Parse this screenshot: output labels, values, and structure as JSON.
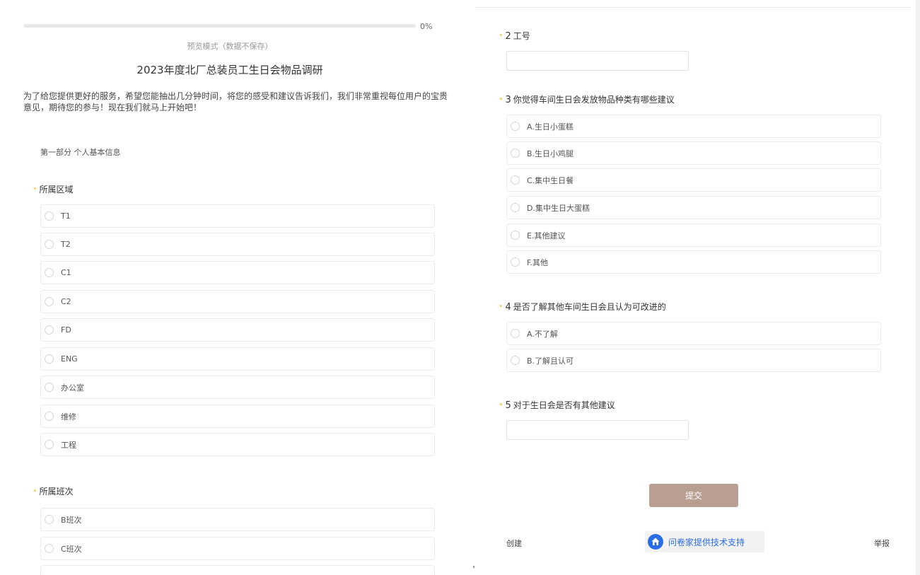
{
  "progress": {
    "percent_text": "0%",
    "value": 0
  },
  "preview_note": "预览模式（数据不保存）",
  "survey": {
    "title": "2023年度北厂总装员工生日会物品调研",
    "intro": "为了给您提供更好的服务，希望您能抽出几分钟时间，将您的感受和建议告诉我们，我们非常重视每位用户的宝贵意见，期待您的参与！现在我们就马上开始吧！",
    "section_title": "第一部分 个人基本信息"
  },
  "q_area": {
    "star": "*",
    "title": "所属区域",
    "options": [
      "T1",
      "T2",
      "C1",
      "C2",
      "FD",
      "ENG",
      "办公室",
      "维修",
      "工程"
    ]
  },
  "q_shift": {
    "star": "*",
    "title": "所属班次",
    "options": [
      "B班次",
      "C班次"
    ]
  },
  "q2": {
    "star": "*",
    "number": "2",
    "title": "工号",
    "value": ""
  },
  "q3": {
    "star": "*",
    "number": "3",
    "title": "你觉得车间生日会发放物品种类有哪些建议",
    "options": [
      "A.生日小蛋糕",
      "B.生日小鸡腿",
      "C.集中生日餐",
      "D.集中生日大蛋糕",
      "E.其他建议",
      "F.其他"
    ]
  },
  "q4": {
    "star": "*",
    "number": "4",
    "title": "是否了解其他车间生日会且认为可改进的",
    "options": [
      "A.不了解",
      "B.了解且认可"
    ]
  },
  "q5": {
    "star": "*",
    "number": "5",
    "title": "对于生日会是否有其他建议",
    "value": ""
  },
  "submit_label": "提交",
  "footer": {
    "create": "创建",
    "tech_support": "问卷家提供技术支持",
    "report": "举报"
  },
  "colors": {
    "accent": "#b89f92",
    "star": "#e6b422",
    "brand_blue": "#2b6de6"
  }
}
